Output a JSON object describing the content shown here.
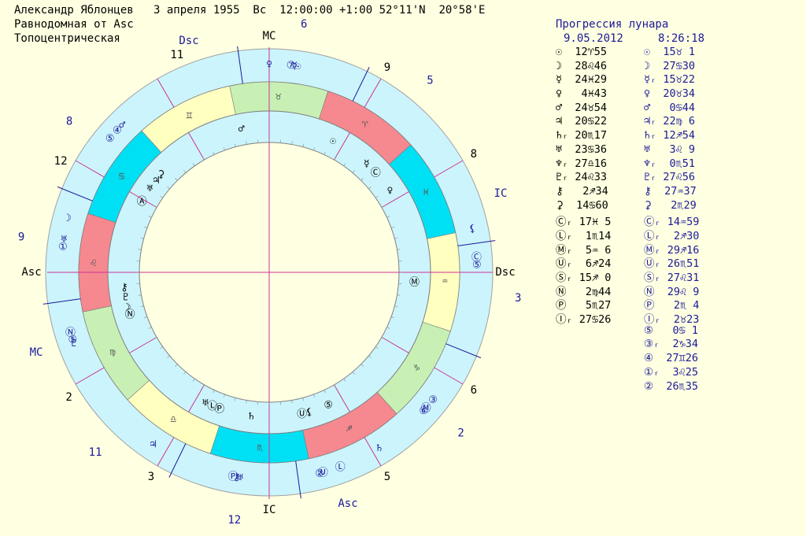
{
  "header": {
    "line1": "Александр Яблонцев   3 апреля 1955  Вс  12:00:00 +1:00 52°11'N  20°58'E",
    "line2": "Равнодомная от Asc",
    "line3": "Топоцентрическая"
  },
  "progression": {
    "title": "Прогрессия лунара",
    "date": "9.05.2012",
    "time": "8:26:18"
  },
  "angle_labels": {
    "mc": "MC",
    "ic": "IC",
    "asc": "Asc",
    "dsc": "Dsc"
  },
  "outer_angle_labels": {
    "dsc": "Dsc",
    "ic": "IC",
    "mc": "MC",
    "asc": "Asc"
  },
  "natal_house_numbers": [
    {
      "label": "11",
      "angle": 113
    },
    {
      "label": "12",
      "angle": 152
    },
    {
      "label": "2",
      "angle": 212
    },
    {
      "label": "3",
      "angle": 240
    },
    {
      "label": "5",
      "angle": 300
    },
    {
      "label": "6",
      "angle": 330
    },
    {
      "label": "8",
      "angle": 30
    },
    {
      "label": "9",
      "angle": 60
    }
  ],
  "prog_house_numbers": [
    {
      "label": "6",
      "angle": 82
    },
    {
      "label": "5",
      "angle": 50
    },
    {
      "label": "3",
      "angle": 354
    },
    {
      "label": "2",
      "angle": 320
    },
    {
      "label": "12",
      "angle": 262
    },
    {
      "label": "11",
      "angle": 226
    },
    {
      "label": "9",
      "angle": 172
    },
    {
      "label": "8",
      "angle": 143
    }
  ],
  "zodiac": [
    {
      "sign": "♉",
      "start": 72,
      "color": "#c8f0b4"
    },
    {
      "sign": "♈",
      "start": 42,
      "color": "#f5898f"
    },
    {
      "sign": "♓",
      "start": 12,
      "color": "#00e0f4"
    },
    {
      "sign": "♒",
      "start": -18,
      "color": "#ffffc0"
    },
    {
      "sign": "♑",
      "start": -48,
      "color": "#c8f0b4"
    },
    {
      "sign": "♐",
      "start": -78,
      "color": "#f5898f"
    },
    {
      "sign": "♏",
      "start": -108,
      "color": "#00e0f4"
    },
    {
      "sign": "♎",
      "start": -138,
      "color": "#ffffc0"
    },
    {
      "sign": "♍",
      "start": -168,
      "color": "#c8f0b4"
    },
    {
      "sign": "♌",
      "start": 162,
      "color": "#f5898f"
    },
    {
      "sign": "♋",
      "start": 132,
      "color": "#00e0f4"
    },
    {
      "sign": "♊",
      "start": 102,
      "color": "#ffffc0"
    }
  ],
  "inner_planets": [
    {
      "glyph": "♂",
      "angle": 101
    },
    {
      "glyph": "☉",
      "angle": 64
    },
    {
      "glyph": "☿",
      "angle": 48
    },
    {
      "glyph": "Ⓒ",
      "angle": 43
    },
    {
      "glyph": "♀",
      "angle": 34
    },
    {
      "glyph": "Ⓜ",
      "angle": 356
    },
    {
      "glyph": "⑤",
      "angle": 294
    },
    {
      "glyph": "⚸",
      "angle": 286
    },
    {
      "glyph": "Ⓤ",
      "angle": 283
    },
    {
      "glyph": "♄",
      "angle": 263
    },
    {
      "glyph": "Ⓟ",
      "angle": 250
    },
    {
      "glyph": "Ⓛ",
      "angle": 247
    },
    {
      "glyph": "♅",
      "angle": 244
    },
    {
      "glyph": "Ⓝ",
      "angle": 197
    },
    {
      "glyph": "☽",
      "angle": 194
    },
    {
      "glyph": "♇",
      "angle": 190
    },
    {
      "glyph": "⚷",
      "angle": 186
    },
    {
      "glyph": "Ⓐ",
      "angle": 151
    },
    {
      "glyph": "♅",
      "angle": 145
    },
    {
      "glyph": "♃",
      "angle": 141
    },
    {
      "glyph": "⚳",
      "angle": 138
    }
  ],
  "outer_planets": [
    {
      "glyph": "⑦",
      "angle": 84
    },
    {
      "glyph": "☿",
      "angle": 83
    },
    {
      "glyph": "☉",
      "angle": 82
    },
    {
      "glyph": "♀",
      "angle": 90
    },
    {
      "glyph": "Ⓒ",
      "angle": 4
    },
    {
      "glyph": "⑤",
      "angle": 2
    },
    {
      "glyph": "⚸",
      "angle": 12
    },
    {
      "glyph": "③",
      "angle": 322
    },
    {
      "glyph": "Ⓜ",
      "angle": 319
    },
    {
      "glyph": "⑥",
      "angle": 318
    },
    {
      "glyph": "♄",
      "angle": 302
    },
    {
      "glyph": "Ⓛ",
      "angle": 290
    },
    {
      "glyph": "Ⓤ",
      "angle": 285
    },
    {
      "glyph": "②",
      "angle": 284
    },
    {
      "glyph": "♅",
      "angle": 262
    },
    {
      "glyph": "⚷",
      "angle": 261
    },
    {
      "glyph": "Ⓟ",
      "angle": 260
    },
    {
      "glyph": "♃",
      "angle": 236
    },
    {
      "glyph": "♇",
      "angle": 200
    },
    {
      "glyph": "⑤",
      "angle": 199
    },
    {
      "glyph": "Ⓝ",
      "angle": 197
    },
    {
      "glyph": "①",
      "angle": 173
    },
    {
      "glyph": "♅",
      "angle": 171
    },
    {
      "glyph": "☽",
      "angle": 165
    },
    {
      "glyph": "⑤",
      "angle": 140
    },
    {
      "glyph": "④",
      "angle": 137
    },
    {
      "glyph": "♂",
      "angle": 135
    }
  ],
  "table": [
    {
      "a": "☉  12♈55",
      "b": "☉  15♉ 1"
    },
    {
      "a": "☽  28♌46",
      "b": "☽  27♋30"
    },
    {
      "a": "☿  24♓29",
      "b": "☿ᵣ 15♉22"
    },
    {
      "a": "♀   4♓43",
      "b": "♀  20♉34"
    },
    {
      "a": "♂  24♉54",
      "b": "♂   0♋44"
    },
    {
      "a": "♃  20♋22",
      "b": "♃ᵣ 22♍ 6"
    },
    {
      "a": "♄ᵣ 20♏17",
      "b": "♄ᵣ 12♐54"
    },
    {
      "a": "♅  23♋36",
      "b": "♅   3♌ 9"
    },
    {
      "a": "♆ᵣ 27♎16",
      "b": "♆ᵣ  0♏51"
    },
    {
      "a": "♇ᵣ 24♌33",
      "b": "♇ᵣ 27♌56"
    },
    {
      "a": "⚷   2♐34",
      "b": "⚷  27♒37"
    },
    {
      "a": "⚳  14♋60",
      "b": "⚳   2♏29"
    },
    {
      "a": "Ⓒᵣ 17♓ 5",
      "b": "Ⓒᵣ 14♒59"
    },
    {
      "a": "Ⓛᵣ  1♏14",
      "b": "Ⓛᵣ  2♐30"
    },
    {
      "a": "Ⓜᵣ  5♒ 6",
      "b": "Ⓜᵣ 29♐16"
    },
    {
      "a": "Ⓤᵣ  6♐24",
      "b": "Ⓤᵣ 26♏51"
    },
    {
      "a": "Ⓢᵣ 15♐ 0",
      "b": "Ⓢᵣ 27♌31"
    },
    {
      "a": "Ⓝ   2♍44",
      "b": "Ⓝ  29♌ 9"
    },
    {
      "a": "Ⓟ   5♏27",
      "b": "Ⓟ   2♏ 4"
    },
    {
      "a": "Ⓘᵣ 27♋26",
      "b": "Ⓘᵣ  2♉23"
    },
    {
      "a": "",
      "b": "⑤   0♋ 1"
    },
    {
      "a": "",
      "b": "③ᵣ  2♑34"
    },
    {
      "a": "",
      "b": "④  27♊26"
    },
    {
      "a": "",
      "b": "①ᵣ  3♌25"
    },
    {
      "a": "",
      "b": "②  26♏35"
    }
  ]
}
